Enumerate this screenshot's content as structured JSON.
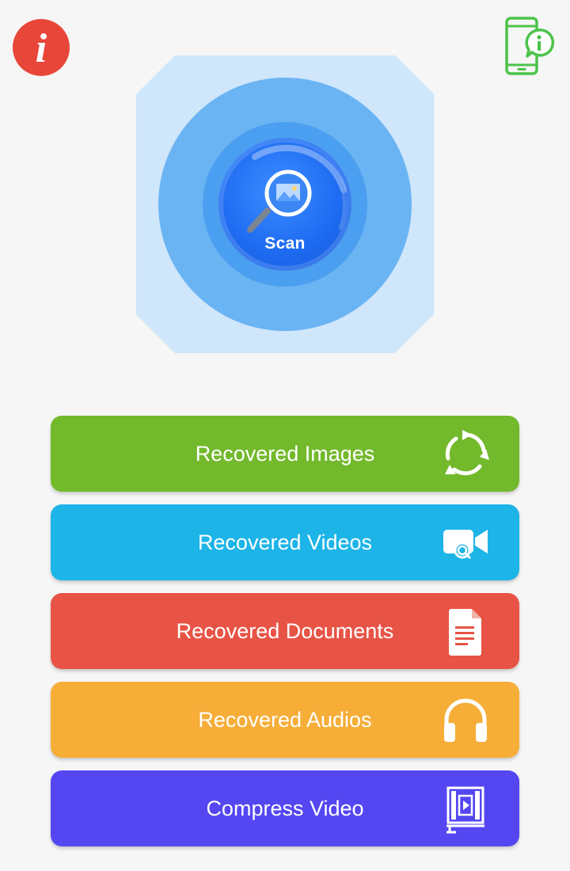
{
  "header": {
    "info_icon_glyph": "i",
    "info_icon_color": "#e9463a",
    "device_info_icon": "phone-info-icon",
    "device_info_color": "#4cc34a"
  },
  "scan": {
    "label": "Scan",
    "icon": "magnifier-image-icon"
  },
  "menu": [
    {
      "label": "Recovered Images",
      "icon": "refresh-cycle-icon",
      "color": "#73b92c"
    },
    {
      "label": "Recovered Videos",
      "icon": "video-camera-search-icon",
      "color": "#1db4e8"
    },
    {
      "label": "Recovered Documents",
      "icon": "document-icon",
      "color": "#e75446"
    },
    {
      "label": "Recovered Audios",
      "icon": "headphones-icon",
      "color": "#f6ae38"
    },
    {
      "label": "Compress Video",
      "icon": "compress-film-icon",
      "color": "#5447f2"
    }
  ]
}
